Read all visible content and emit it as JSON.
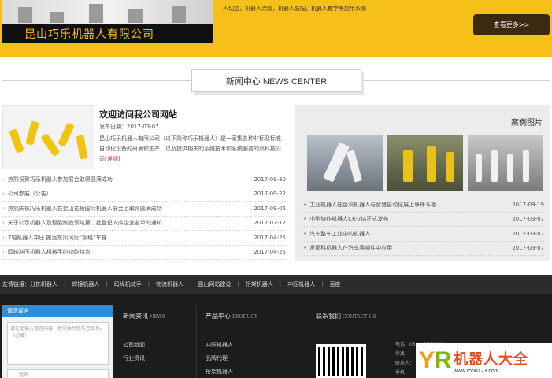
{
  "top": {
    "company_name": "昆山巧乐机器人有限公司",
    "description": "人切边，机器人涂胶，机器人装配，机器人教学等应用系统",
    "more_button": "查看更多>>"
  },
  "section": {
    "title": "新闻中心 NEWS CENTER"
  },
  "feature": {
    "title": "欢迎访问我公司网站",
    "date": "发布日期：2017-03-07",
    "text": "昆山巧乐机器人有限公司（以下简称巧乐机器人）是一家集各种非标及标准自动化设备的研发和生产，以及提供相关的系统技术和系统服务的高科技公司",
    "detail_link": "[详细]"
  },
  "news_list": [
    {
      "title": "热烈祝贺巧乐机器人参加展会取得圆满成功",
      "date": "2017-09-30"
    },
    {
      "title": "公司参展（公告）",
      "date": "2017-09-22"
    },
    {
      "title": "热烈庆祝巧乐机器人在昆山花桥国际机器人展会上取得圆满成功",
      "date": "2017-09-06"
    },
    {
      "title": "关于公示机器人及智能制造领域第二批登记入库企业名单的通知",
      "date": "2017-07-17"
    },
    {
      "title": "7轴机器人冲压 搬运东风风行“钢格”车身",
      "date": "2017-04-25"
    },
    {
      "title": "四轴冲压机器人机械手的功能特点",
      "date": "2017-04-25"
    }
  ],
  "cases": {
    "title": "案例图片",
    "items": [
      {
        "title": "工业机器人在台湾机器人与智慧自动化展上争锋斗艳",
        "date": "2017-09-19"
      },
      {
        "title": "小型协作机器人CR-7iA正式发布",
        "date": "2017-03-07"
      },
      {
        "title": "汽车整车工业中的机器人",
        "date": "2017-03-07"
      },
      {
        "title": "发那科机器人在汽车零部件中应用",
        "date": "2017-03-07"
      }
    ]
  },
  "friend_links": {
    "label": "友情链接：",
    "items": [
      "分拣机器人",
      "焊接机器人",
      "码垛机械手",
      "物流机器人",
      "昆山网站建设",
      "桁架机器人",
      "冲压机器人",
      "百度"
    ]
  },
  "footer": {
    "message": {
      "header": "请您留言",
      "placeholder": "请在此输入留言内容，我们会尽快与您联系。（必填）",
      "name_placeholder": "姓名"
    },
    "news_col": {
      "title": "新闻资讯",
      "sub": "NEWS",
      "items": [
        "公司新闻",
        "行业资讯"
      ]
    },
    "product_col": {
      "title": "产品中心",
      "sub": "PRODUCT",
      "items": [
        "冲压机器人",
        "品牌代理",
        "桁架机器人"
      ]
    },
    "contact_col": {
      "title": "联系我们",
      "sub": "CONTACT US",
      "lines": [
        "电话：0512-57739628",
        "传真：",
        "联系人：",
        "手机："
      ]
    }
  },
  "watermark": {
    "name": "机器人大全",
    "url": "www.robo123.com"
  }
}
